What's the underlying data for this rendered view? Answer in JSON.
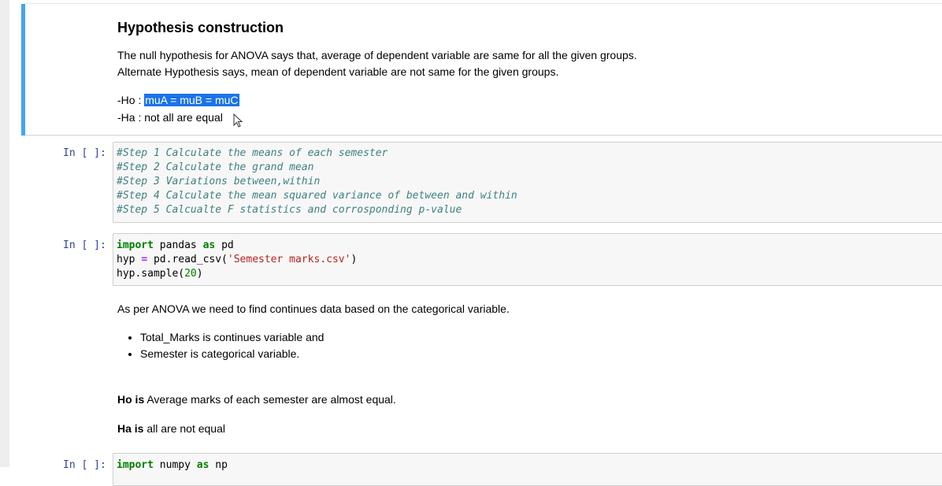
{
  "md_cell_1": {
    "heading": "Hypothesis construction",
    "line1": "The null hypothesis for ANOVA says that, average of dependent variable are same for all the given groups.",
    "line2": "Alternate Hypothesis says, mean of dependent variable are not same for the given groups.",
    "ho_prefix": "-Ho : ",
    "ho_selected": "muA = muB = muC",
    "ha": "-Ha : not all are equal"
  },
  "code_cell_1": {
    "prompt": "In [ ]:",
    "lines": [
      "#Step 1 Calculate the means of each semester",
      "#Step 2 Calculate the grand mean",
      "#Step 3 Variations between,within",
      "#Step 4 Calculate the mean squared variance of between and within",
      "#Step 5 Calcualte F statistics and corrosponding p-value"
    ]
  },
  "code_cell_2": {
    "prompt": "In [ ]:",
    "kw_import": "import",
    "mod_pandas": " pandas ",
    "kw_as": "as",
    "alias_pd": " pd",
    "l2_a": "hyp ",
    "l2_eq": "=",
    "l2_b": " pd.read_csv(",
    "l2_str": "'Semester marks.csv'",
    "l2_c": ")",
    "l3_a": "hyp.sample(",
    "l3_num": "20",
    "l3_c": ")"
  },
  "md_cell_2": {
    "intro": "As per ANOVA we need to find continues data based on the categorical variable.",
    "bullets": [
      "Total_Marks is continues variable and",
      "Semester is categorical variable."
    ],
    "ho_bold": "Ho is",
    "ho_text": " Average marks of each semester are almost equal.",
    "ha_bold": "Ha is",
    "ha_text": " all are not equal"
  },
  "code_cell_3": {
    "prompt": "In [ ]:",
    "kw_import": "import",
    "mod": " numpy ",
    "kw_as": "as",
    "alias": " np"
  },
  "colors": {
    "selected_cell_border": "#42a5f5",
    "prompt": "#303f9f",
    "comment": "#408080",
    "keyword": "#008000",
    "string": "#ba2121",
    "selection": "#1a73e8"
  }
}
